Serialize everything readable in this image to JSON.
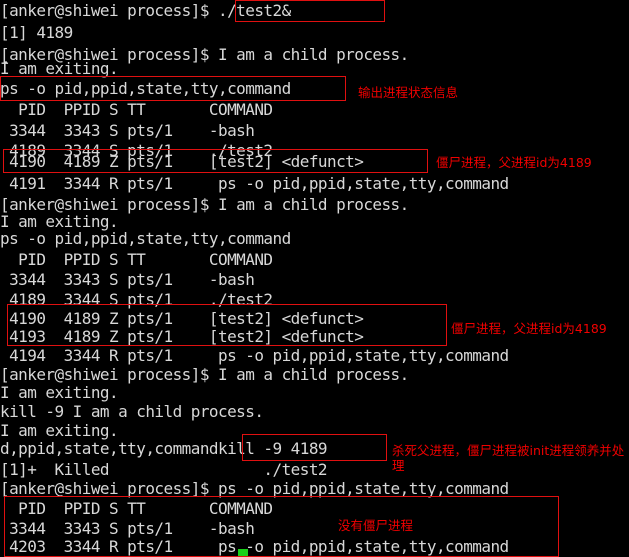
{
  "terminal": {
    "title": "anker@shiwei process",
    "prompt": "[anker@shiwei process]$",
    "background_color": "#000000",
    "foreground_color": "#d8d8d8",
    "annotation_color": "#ff0000",
    "cursor_color": "#18d018",
    "lines": [
      {
        "id": "l1",
        "text": "[anker@shiwei process]$ ./test2&"
      },
      {
        "id": "l2",
        "text": "[1] 4189"
      },
      {
        "id": "l3",
        "text": "[anker@shiwei process]$ I am a child process."
      },
      {
        "id": "l4",
        "text": "I am exiting."
      },
      {
        "id": "l5",
        "text": "ps -o pid,ppid,state,tty,command"
      },
      {
        "id": "l6",
        "text": "  PID  PPID S TT       COMMAND"
      },
      {
        "id": "l7",
        "text": " 3344  3343 S pts/1    -bash"
      },
      {
        "id": "l8",
        "text": " 4189  3344 S pts/1    ./test2"
      },
      {
        "id": "l9",
        "text": " 4190  4189 Z pts/1    [test2] <defunct>"
      },
      {
        "id": "l10",
        "text": " 4191  3344 R pts/1     ps -o pid,ppid,state,tty,command"
      },
      {
        "id": "l11",
        "text": "[anker@shiwei process]$ I am a child process."
      },
      {
        "id": "l12",
        "text": "I am exiting."
      },
      {
        "id": "l13",
        "text": "ps -o pid,ppid,state,tty,command"
      },
      {
        "id": "l14",
        "text": "  PID  PPID S TT       COMMAND"
      },
      {
        "id": "l15",
        "text": " 3344  3343 S pts/1    -bash"
      },
      {
        "id": "l16",
        "text": " 4189  3344 S pts/1    ./test2"
      },
      {
        "id": "l17",
        "text": " 4190  4189 Z pts/1    [test2] <defunct>"
      },
      {
        "id": "l18",
        "text": " 4193  4189 Z pts/1    [test2] <defunct>"
      },
      {
        "id": "l19",
        "text": " 4194  3344 R pts/1     ps -o pid,ppid,state,tty,command"
      },
      {
        "id": "l20",
        "text": "[anker@shiwei process]$ I am a child process."
      },
      {
        "id": "l21",
        "text": "I am exiting."
      },
      {
        "id": "l22",
        "text": "kill -9 I am a child process."
      },
      {
        "id": "l23",
        "text": "I am exiting."
      },
      {
        "id": "l24",
        "text": "d,ppid,state,tty,commandkill -9 4189"
      },
      {
        "id": "l25",
        "text": "[1]+  Killed                 ./test2"
      },
      {
        "id": "l26",
        "text": "[anker@shiwei process]$ ps -o pid,ppid,state,tty,command"
      },
      {
        "id": "l27",
        "text": "  PID  PPID S TT       COMMAND"
      },
      {
        "id": "l28",
        "text": " 3344  3343 S pts/1    -bash"
      },
      {
        "id": "l29",
        "text": " 4203  3344 R pts/1     ps -o pid,ppid,state,tty,command"
      }
    ]
  },
  "annotations": [
    {
      "id": "a1",
      "text": "输出进程状态信息"
    },
    {
      "id": "a2",
      "text": "僵尸进程，父进程id为4189"
    },
    {
      "id": "a3",
      "text": "僵尸进程，父进程id为4189"
    },
    {
      "id": "a4",
      "text": "杀死父进程，僵尸进程被init进程领养并处理"
    },
    {
      "id": "a5",
      "text": "没有僵尸进程"
    }
  ],
  "highlight_boxes": [
    {
      "id": "b1",
      "label": "run-test2-background"
    },
    {
      "id": "b2",
      "label": "ps-command-1"
    },
    {
      "id": "b3",
      "label": "zombie-row-4190"
    },
    {
      "id": "b4",
      "label": "zombie-rows-4190-4193"
    },
    {
      "id": "b5",
      "label": "kill-command"
    },
    {
      "id": "b6",
      "label": "final-ps-output"
    }
  ]
}
